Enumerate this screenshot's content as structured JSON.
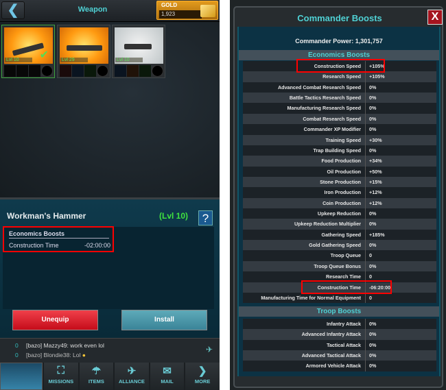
{
  "left": {
    "header": {
      "title": "Weapon",
      "back_icon": "chevron-left-icon",
      "gold_label": "GOLD",
      "gold_value": "1,923"
    },
    "slots": [
      {
        "level": "Lvl 10",
        "selected": true,
        "equipped": true,
        "style": "gold"
      },
      {
        "level": "Lvl 29",
        "style": "gold"
      },
      {
        "level": "Lvl 10",
        "style": "grey"
      }
    ],
    "detail": {
      "name": "Workman's Hammer",
      "level": "(Lvl 10)",
      "help": "?",
      "boost_header": "Economics Boosts",
      "boost_key": "Construction Time",
      "boost_value": "-02:00:00",
      "unequip": "Unequip",
      "install": "Install"
    },
    "chat": {
      "lines": [
        {
          "count": "0",
          "text": "[bazo] Mazzy49: work even lol"
        },
        {
          "count": "0",
          "text": "[bazo] Blondie38: Lol"
        }
      ]
    },
    "nav": [
      {
        "label": "MISSIONS",
        "icon": "target-icon"
      },
      {
        "label": "ITEMS",
        "icon": "parachute-icon"
      },
      {
        "label": "ALLIANCE",
        "icon": "eagle-icon"
      },
      {
        "label": "MAIL",
        "icon": "envelope-icon"
      },
      {
        "label": "MORE",
        "icon": "chevron-right-icon"
      }
    ]
  },
  "right": {
    "title": "Commander Boosts",
    "close": "X",
    "power": "Commander Power: 1,301,757",
    "economics_header": "Economics Boosts",
    "economics": [
      {
        "k": "Construction Speed",
        "v": "+105%"
      },
      {
        "k": "Research Speed",
        "v": "+105%"
      },
      {
        "k": "Advanced Combat Research Speed",
        "v": "0%"
      },
      {
        "k": "Battle Tactics Research Speed",
        "v": "0%"
      },
      {
        "k": "Manufacturing Research Speed",
        "v": "0%"
      },
      {
        "k": "Combat Research Speed",
        "v": "0%"
      },
      {
        "k": "Commander XP Modifier",
        "v": "0%"
      },
      {
        "k": "Training Speed",
        "v": "+30%"
      },
      {
        "k": "Trap Building Speed",
        "v": "0%"
      },
      {
        "k": "Food Production",
        "v": "+34%"
      },
      {
        "k": "Oil Production",
        "v": "+50%"
      },
      {
        "k": "Stone Production",
        "v": "+15%"
      },
      {
        "k": "Iron Production",
        "v": "+12%"
      },
      {
        "k": "Coin Production",
        "v": "+12%"
      },
      {
        "k": "Upkeep Reduction",
        "v": "0%"
      },
      {
        "k": "Upkeep Reduction Multiplier",
        "v": "0%"
      },
      {
        "k": "Gathering Speed",
        "v": "+185%"
      },
      {
        "k": "Gold Gathering Speed",
        "v": "0%"
      },
      {
        "k": "Troop Queue",
        "v": "0"
      },
      {
        "k": "Troop Queue Bonus",
        "v": "0%"
      },
      {
        "k": "Research Time",
        "v": "0"
      },
      {
        "k": "Construction Time",
        "v": "-06:20:00"
      },
      {
        "k": "Manufacturing Time for Normal Equipment",
        "v": "0"
      }
    ],
    "troop_header": "Troop Boosts",
    "troop": [
      {
        "k": "Infantry Attack",
        "v": "0%"
      },
      {
        "k": "Advanced Infantry Attack",
        "v": "0%"
      },
      {
        "k": "Tactical Attack",
        "v": "0%"
      },
      {
        "k": "Advanced Tactical Attack",
        "v": "0%"
      },
      {
        "k": "Armored Vehicle Attack",
        "v": "0%"
      }
    ],
    "highlight_color": "#ff0000"
  }
}
